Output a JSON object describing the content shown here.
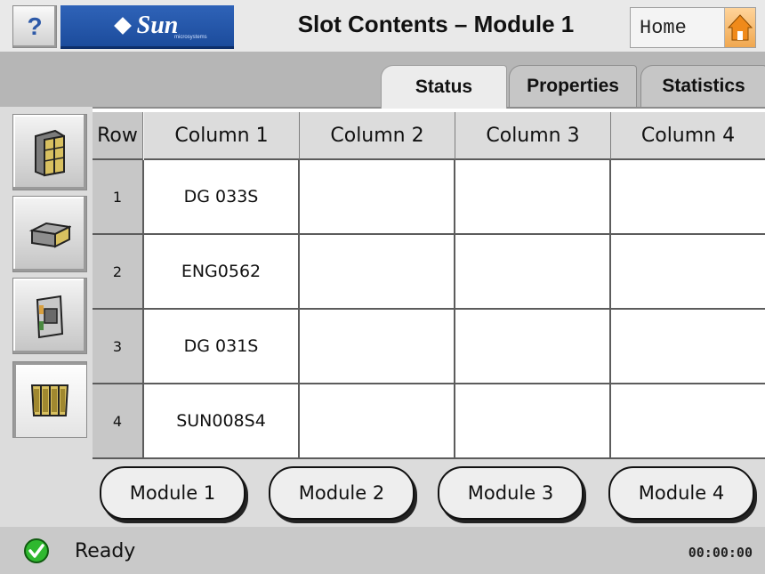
{
  "header": {
    "help_label": "?",
    "logo_text": "Sun",
    "logo_subtext": "microsystems",
    "title": "Slot Contents – Module 1",
    "home_label": "Home",
    "home_icon": "house-icon"
  },
  "tabs": [
    {
      "label": "Status",
      "active": true
    },
    {
      "label": "Properties",
      "active": false
    },
    {
      "label": "Statistics",
      "active": false
    }
  ],
  "sidebar": {
    "icons": [
      "tower-enclosure-icon",
      "tape-drive-icon",
      "tape-cartridge-icon",
      "tape-magazine-icon"
    ],
    "selected_index": 3
  },
  "table": {
    "columns": [
      "Row",
      "Column 1",
      "Column 2",
      "Column 3",
      "Column 4"
    ],
    "rows": [
      {
        "row": "1",
        "cells": [
          "DG 033S",
          "",
          "",
          ""
        ]
      },
      {
        "row": "2",
        "cells": [
          "ENG0562",
          "",
          "",
          ""
        ]
      },
      {
        "row": "3",
        "cells": [
          "DG 031S",
          "",
          "",
          ""
        ]
      },
      {
        "row": "4",
        "cells": [
          "SUN008S4",
          "",
          "",
          ""
        ]
      }
    ]
  },
  "modules": [
    "Module 1",
    "Module 2",
    "Module 3",
    "Module 4"
  ],
  "status": {
    "icon": "checkmark-ok-icon",
    "text": "Ready",
    "time": "00:00:00"
  },
  "colors": {
    "logo_blue": "#2f63b8",
    "ok_green": "#2fb82f",
    "home_orange": "#f08a1a"
  }
}
